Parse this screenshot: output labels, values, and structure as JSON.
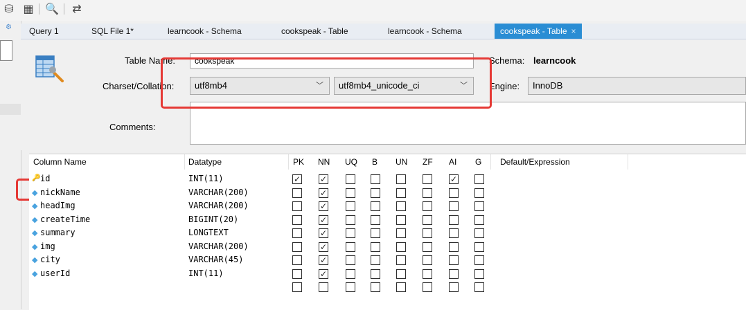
{
  "tabs": [
    {
      "label": "Query 1"
    },
    {
      "label": "SQL File 1*"
    },
    {
      "label": "learncook - Schema"
    },
    {
      "label": "cookspeak - Table"
    },
    {
      "label": "learncook - Schema"
    },
    {
      "label": "cookspeak - Table",
      "active": true,
      "close": "×"
    }
  ],
  "form": {
    "table_name_label": "Table Name:",
    "table_name_value": "cookspeak",
    "schema_label": "Schema:",
    "schema_value": "learncook",
    "charset_label": "Charset/Collation:",
    "charset_value": "utf8mb4",
    "collation_value": "utf8mb4_unicode_ci",
    "engine_label": "Engine:",
    "engine_value": "InnoDB",
    "comments_label": "Comments:",
    "comments_value": ""
  },
  "grid": {
    "headers": {
      "column_name": "Column Name",
      "datatype": "Datatype",
      "pk": "PK",
      "nn": "NN",
      "uq": "UQ",
      "b": "B",
      "un": "UN",
      "zf": "ZF",
      "ai": "AI",
      "g": "G",
      "default": "Default/Expression"
    },
    "rows": [
      {
        "name": "id",
        "type": "INT(11)",
        "icon": "primary-key-icon",
        "pk": true,
        "nn": true,
        "uq": false,
        "b": false,
        "un": false,
        "zf": false,
        "ai": true,
        "g": false
      },
      {
        "name": "nickName",
        "type": "VARCHAR(200)",
        "icon": "column-diamond-icon",
        "pk": false,
        "nn": true,
        "uq": false,
        "b": false,
        "un": false,
        "zf": false,
        "ai": false,
        "g": false
      },
      {
        "name": "headImg",
        "type": "VARCHAR(200)",
        "icon": "column-diamond-icon",
        "pk": false,
        "nn": true,
        "uq": false,
        "b": false,
        "un": false,
        "zf": false,
        "ai": false,
        "g": false
      },
      {
        "name": "createTime",
        "type": "BIGINT(20)",
        "icon": "column-diamond-icon",
        "pk": false,
        "nn": true,
        "uq": false,
        "b": false,
        "un": false,
        "zf": false,
        "ai": false,
        "g": false
      },
      {
        "name": "summary",
        "type": "LONGTEXT",
        "icon": "column-diamond-icon",
        "pk": false,
        "nn": true,
        "uq": false,
        "b": false,
        "un": false,
        "zf": false,
        "ai": false,
        "g": false
      },
      {
        "name": "img",
        "type": "VARCHAR(200)",
        "icon": "column-diamond-icon",
        "pk": false,
        "nn": true,
        "uq": false,
        "b": false,
        "un": false,
        "zf": false,
        "ai": false,
        "g": false
      },
      {
        "name": "city",
        "type": "VARCHAR(45)",
        "icon": "column-diamond-icon",
        "pk": false,
        "nn": true,
        "uq": false,
        "b": false,
        "un": false,
        "zf": false,
        "ai": false,
        "g": false
      },
      {
        "name": "userId",
        "type": "INT(11)",
        "icon": "column-diamond-icon",
        "pk": false,
        "nn": true,
        "uq": false,
        "b": false,
        "un": false,
        "zf": false,
        "ai": false,
        "g": false
      },
      {
        "name": "",
        "type": "",
        "icon": "",
        "pk": false,
        "nn": false,
        "uq": false,
        "b": false,
        "un": false,
        "zf": false,
        "ai": false,
        "g": false
      }
    ]
  },
  "colors": {
    "active_tab": "#2a8dd4",
    "annotation_red": "#e53935",
    "key_yellow": "#e5b400",
    "diamond_blue": "#4aa3df"
  }
}
